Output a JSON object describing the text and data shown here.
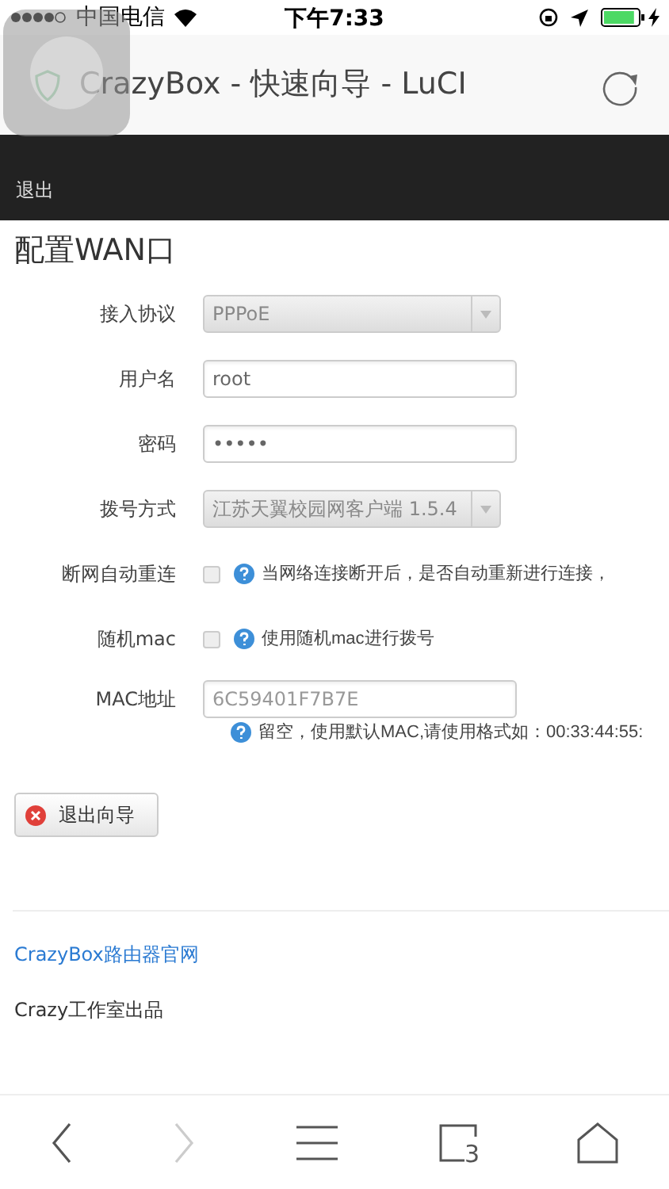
{
  "status_bar": {
    "carrier": "中国电信",
    "time": "下午7:33"
  },
  "browser": {
    "title": "CrazyBox - 快速向导 - LuCI"
  },
  "nav": {
    "items": [
      {
        "label": "退出"
      }
    ]
  },
  "heading": "配置WAN口",
  "fields": [
    {
      "kind": "select",
      "label": "接入协议",
      "value": "PPPoE"
    },
    {
      "kind": "text",
      "label": "用户名",
      "value": "root"
    },
    {
      "kind": "password",
      "label": "密码",
      "value": "•••••"
    },
    {
      "kind": "select",
      "label": "拨号方式",
      "value": "江苏天翼校园网客户端 1.5.4"
    },
    {
      "kind": "checkbox",
      "label": "断网自动重连",
      "checked": false,
      "hint": "当网络连接断开后，是否自动重新进行连接，"
    },
    {
      "kind": "checkbox",
      "label": "随机mac",
      "checked": false,
      "hint": "使用随机mac进行拨号"
    },
    {
      "kind": "text",
      "label": "MAC地址",
      "placeholder": "6C59401F7B7E",
      "hint": "留空，使用默认MAC,请使用格式如：00:33:44:55:"
    }
  ],
  "buttons": [
    {
      "label": "退出向导"
    }
  ],
  "footer": {
    "link": "CrazyBox路由器官网",
    "credit": "Crazy工作室出品"
  },
  "toolbar": {
    "back_disabled": false,
    "forward_disabled": true,
    "tab_count": "3"
  }
}
